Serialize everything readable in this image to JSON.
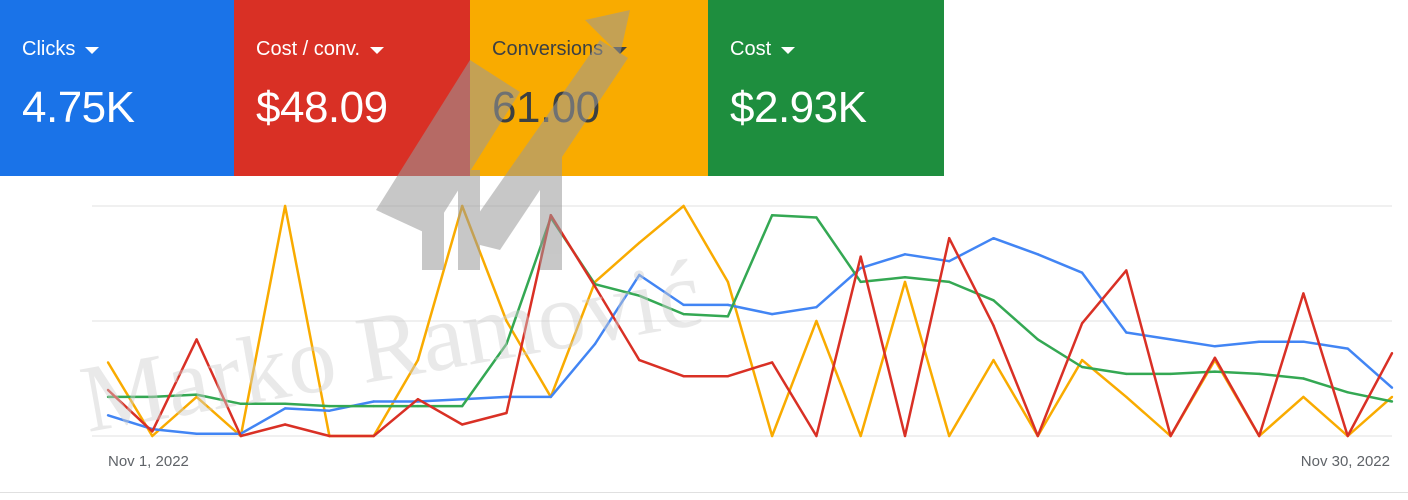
{
  "metrics": [
    {
      "label": "Clicks",
      "value": "4.75K",
      "bg": "#1a73e8",
      "fg": "#ffffff"
    },
    {
      "label": "Cost / conv.",
      "value": "$48.09",
      "bg": "#d93025",
      "fg": "#ffffff"
    },
    {
      "label": "Conversions",
      "value": "61.00",
      "bg": "#f9ab00",
      "fg": "#3c4043"
    },
    {
      "label": "Cost",
      "value": "$2.93K",
      "bg": "#1e8e3e",
      "fg": "#ffffff"
    }
  ],
  "watermark": {
    "text": "Marko Ramović"
  },
  "chart_data": {
    "type": "line",
    "x_start_label": "Nov 1, 2022",
    "x_end_label": "Nov 30, 2022",
    "points_per_series": 30,
    "grid": true,
    "legend": "metric cards above chart",
    "series": [
      {
        "name": "Clicks",
        "color": "#4285f4",
        "values": [
          0.09,
          0.03,
          0.01,
          0.01,
          0.12,
          0.11,
          0.15,
          0.15,
          0.16,
          0.17,
          0.17,
          0.4,
          0.7,
          0.57,
          0.57,
          0.53,
          0.56,
          0.73,
          0.79,
          0.76,
          0.86,
          0.79,
          0.71,
          0.45,
          0.42,
          0.39,
          0.41,
          0.41,
          0.38,
          0.21
        ]
      },
      {
        "name": "Cost / conv.",
        "color": "#d93025",
        "values": [
          0.2,
          0.02,
          0.42,
          0.0,
          0.05,
          0.0,
          0.0,
          0.16,
          0.05,
          0.1,
          0.96,
          0.65,
          0.33,
          0.26,
          0.26,
          0.32,
          0.0,
          0.78,
          0.0,
          0.86,
          0.48,
          0.0,
          0.49,
          0.72,
          0.0,
          0.34,
          0.0,
          0.62,
          0.0,
          0.36
        ]
      },
      {
        "name": "Conversions",
        "color": "#f9ab00",
        "values": [
          0.32,
          0.0,
          0.17,
          0.0,
          1.0,
          0.0,
          0.0,
          0.33,
          1.0,
          0.5,
          0.17,
          0.67,
          0.84,
          1.0,
          0.67,
          0.0,
          0.5,
          0.0,
          0.67,
          0.0,
          0.33,
          0.0,
          0.33,
          0.17,
          0.0,
          0.33,
          0.0,
          0.17,
          0.0,
          0.17
        ]
      },
      {
        "name": "Cost",
        "color": "#34a853",
        "values": [
          0.17,
          0.17,
          0.18,
          0.14,
          0.14,
          0.13,
          0.13,
          0.13,
          0.13,
          0.4,
          0.95,
          0.66,
          0.61,
          0.53,
          0.52,
          0.96,
          0.95,
          0.67,
          0.69,
          0.67,
          0.59,
          0.42,
          0.3,
          0.27,
          0.27,
          0.28,
          0.27,
          0.25,
          0.19,
          0.15
        ]
      }
    ]
  }
}
